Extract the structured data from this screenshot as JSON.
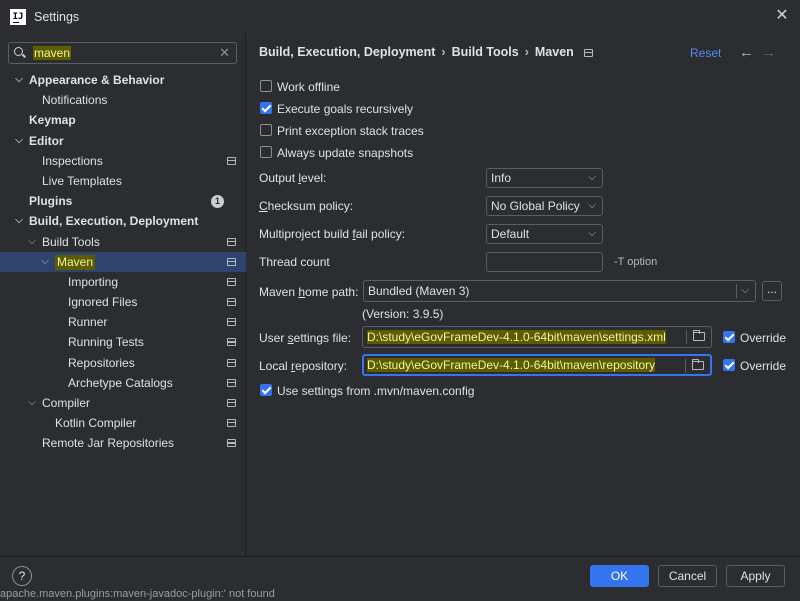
{
  "window": {
    "title": "Settings",
    "app_icon": "IJ"
  },
  "search": {
    "value": "maven",
    "placeholder": ""
  },
  "tree": [
    {
      "label": "Appearance & Behavior",
      "level": 0,
      "bold": true,
      "chevron": "down"
    },
    {
      "label": "Notifications",
      "level": 1
    },
    {
      "label": "Keymap",
      "level": 0,
      "bold": true
    },
    {
      "label": "Editor",
      "level": 0,
      "bold": true,
      "chevron": "down"
    },
    {
      "label": "Inspections",
      "level": 1,
      "project": true
    },
    {
      "label": "Live Templates",
      "level": 1
    },
    {
      "label": "Plugins",
      "level": 0,
      "bold": true,
      "badge": "1"
    },
    {
      "label": "Build, Execution, Deployment",
      "level": 0,
      "bold": true,
      "chevron": "down"
    },
    {
      "label": "Build Tools",
      "level": 1,
      "chevron": "down",
      "project": true
    },
    {
      "label": "Maven",
      "level": 2,
      "chevron": "down",
      "project": true,
      "selected": true,
      "highlight": true
    },
    {
      "label": "Importing",
      "level": 3,
      "project": true
    },
    {
      "label": "Ignored Files",
      "level": 3,
      "project": true
    },
    {
      "label": "Runner",
      "level": 3,
      "project": true
    },
    {
      "label": "Running Tests",
      "level": 3,
      "project": true
    },
    {
      "label": "Repositories",
      "level": 3,
      "project": true
    },
    {
      "label": "Archetype Catalogs",
      "level": 3,
      "project": true
    },
    {
      "label": "Compiler",
      "level": 1,
      "chevron": "down",
      "project": true
    },
    {
      "label": "Kotlin Compiler",
      "level": 2,
      "project": true
    },
    {
      "label": "Remote Jar Repositories",
      "level": 1,
      "project": true
    }
  ],
  "breadcrumb": {
    "part1": "Build, Execution, Deployment",
    "part2": "Build Tools",
    "part3": "Maven",
    "sep": "›"
  },
  "header": {
    "reset": "Reset",
    "back": "←",
    "forward": "→"
  },
  "checkboxes": {
    "work_offline": {
      "label": "Work offline",
      "checked": false
    },
    "execute_goals": {
      "label": "Execute goals recursively",
      "checked": true
    },
    "print_exception": {
      "label": "Print exception stack traces",
      "checked": false
    },
    "always_update": {
      "label": "Always update snapshots",
      "checked": false
    },
    "use_mvn_config": {
      "label": "Use settings from .mvn/maven.config",
      "checked": true
    }
  },
  "fields": {
    "output_level": {
      "label_pre": "Output ",
      "label_u": "l",
      "label_post": "evel:",
      "value": "Info"
    },
    "checksum_policy": {
      "label_pre": "",
      "label_u": "C",
      "label_post": "hecksum policy:",
      "value": "No Global Policy"
    },
    "multiproject": {
      "label_pre": "Multiproject build ",
      "label_u": "f",
      "label_post": "ail policy:",
      "value": "Default"
    },
    "thread_count": {
      "label": "Thread count",
      "value": "",
      "hint": "-T option"
    },
    "maven_home": {
      "label_pre": "Maven ",
      "label_u": "h",
      "label_post": "ome path:",
      "value": "Bundled (Maven 3)",
      "version": "(Version: 3.9.5)",
      "browse": "..."
    },
    "user_settings": {
      "label_pre": "User ",
      "label_u": "s",
      "label_post": "ettings file:",
      "value": "D:\\study\\eGovFrameDev-4.1.0-64bit\\maven\\settings.xml",
      "override_label": "Override",
      "override": true
    },
    "local_repo": {
      "label_pre": "Local ",
      "label_u": "r",
      "label_post": "epository:",
      "value": "D:\\study\\eGovFrameDev-4.1.0-64bit\\maven\\repository",
      "override_label": "Override",
      "override": true
    }
  },
  "footer": {
    "help": "?",
    "ok": "OK",
    "cancel": "Cancel",
    "apply": "Apply"
  },
  "status_strip": "apache.maven.plugins:maven-javadoc-plugin:' not found",
  "colors": {
    "accent": "#3574f0",
    "selection": "#2e436e",
    "highlight": "#5c5c00",
    "link": "#548af7",
    "background": "#2b2d30"
  }
}
